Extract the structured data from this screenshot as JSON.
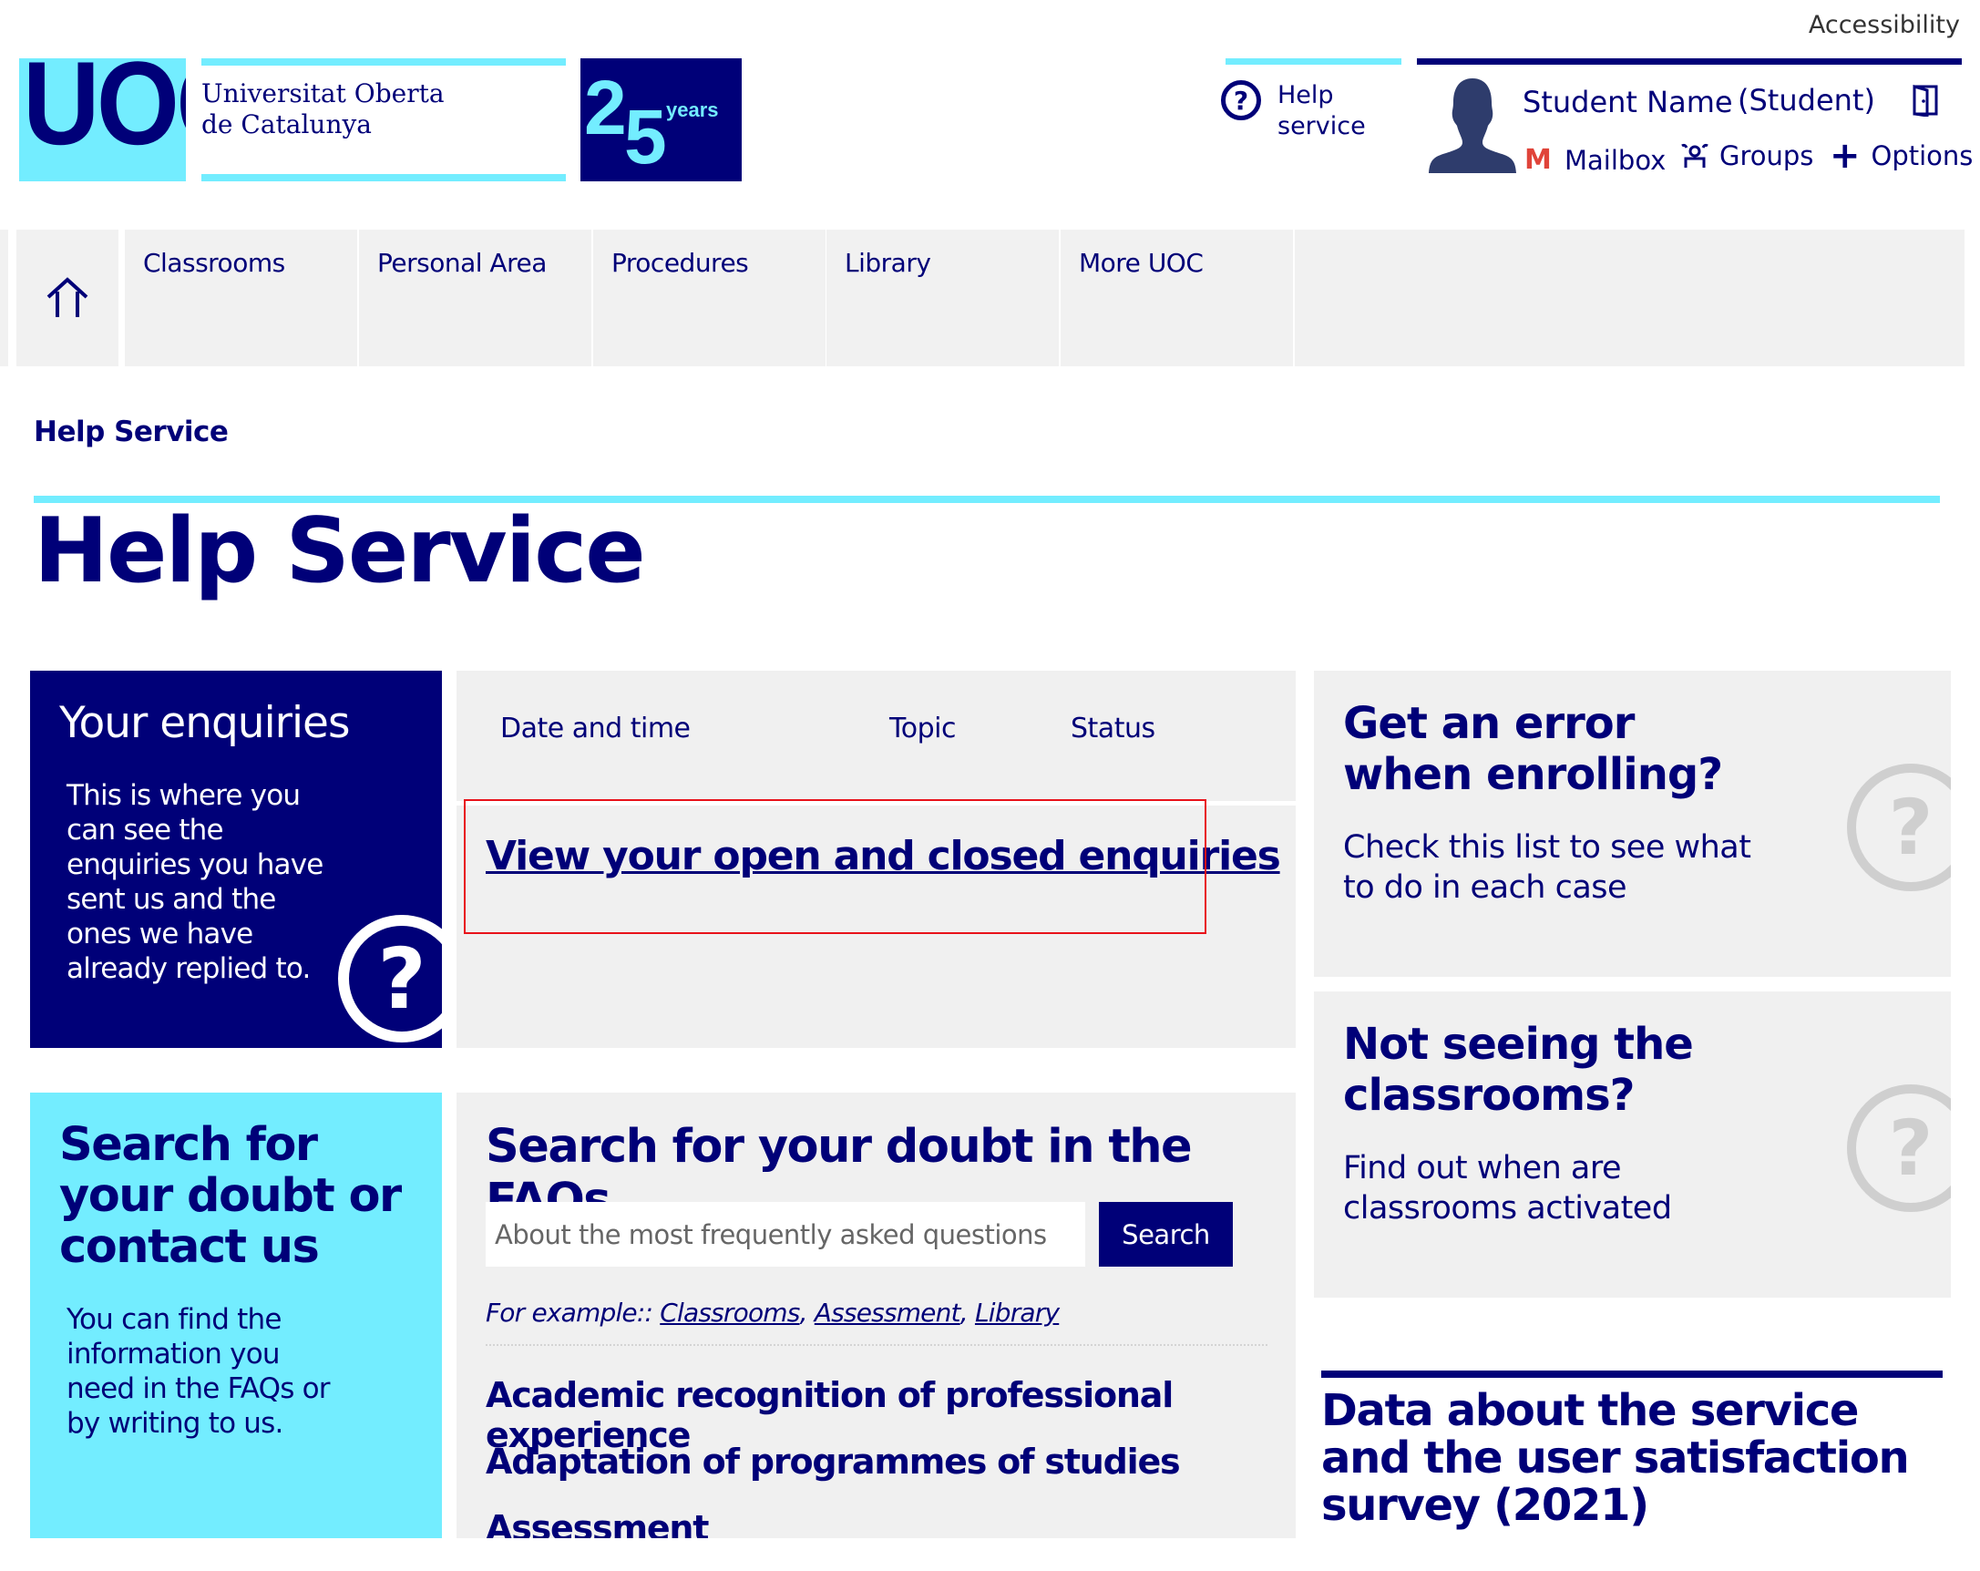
{
  "header": {
    "accessibility_label": "Accessibility",
    "logo": {
      "uoc_text": "UOC",
      "name_line1": "Universitat Oberta",
      "name_line2": "de Catalunya",
      "anniversary_number_1": "2",
      "anniversary_number_2": "5",
      "anniversary_label": "years"
    },
    "help_service": {
      "icon": "question-circle-icon",
      "line1": "Help",
      "line2": "service"
    },
    "user": {
      "name": "Student Name",
      "role": "(Student)",
      "mailbox_label": "Mailbox",
      "groups_label": "Groups",
      "options_label": "Options"
    },
    "colors": {
      "navy": "#000078",
      "cyan": "#73edff",
      "gray_panel": "#f0f0f0",
      "mail_red": "#e0443a",
      "highlight_red": "#e8121a"
    }
  },
  "nav": {
    "home_icon": "home-icon",
    "items": [
      {
        "label": "Classrooms"
      },
      {
        "label": "Personal Area"
      },
      {
        "label": "Procedures"
      },
      {
        "label": "Library"
      },
      {
        "label": "More UOC"
      }
    ]
  },
  "breadcrumb": {
    "current": "Help Service"
  },
  "page": {
    "title": "Help Service"
  },
  "enquiries": {
    "title": "Your enquiries",
    "description": "This is where you can see the enquiries you have sent us and the ones we have already replied to.",
    "table_headers": [
      "Date and time",
      "Topic",
      "Status"
    ],
    "link_label": "View your open and closed enquiries"
  },
  "cards": [
    {
      "title_line1": "Get an error",
      "title_line2": "when enrolling?",
      "text_line1": "Check this list to see what",
      "text_line2": "to do in each case"
    },
    {
      "title_line1": "Not seeing the",
      "title_line2": "classrooms?",
      "text_line1": "Find out when are",
      "text_line2": "classrooms activated"
    }
  ],
  "contact": {
    "title": "Search for your doubt or contact us",
    "description": "You can find the information you need in the FAQs or by writing to us."
  },
  "faq": {
    "title": "Search for your doubt in the FAQs",
    "search_placeholder": "About the most frequently asked questions",
    "search_value": "",
    "search_button": "Search",
    "example_prefix": "For example::",
    "examples": [
      "Classrooms",
      "Assessment",
      "Library"
    ],
    "topics": [
      "Academic recognition of professional experience",
      "Adaptation of programmes of studies",
      "Assessment"
    ]
  },
  "survey": {
    "title": "Data about the service and the user satisfaction survey (2021)"
  }
}
